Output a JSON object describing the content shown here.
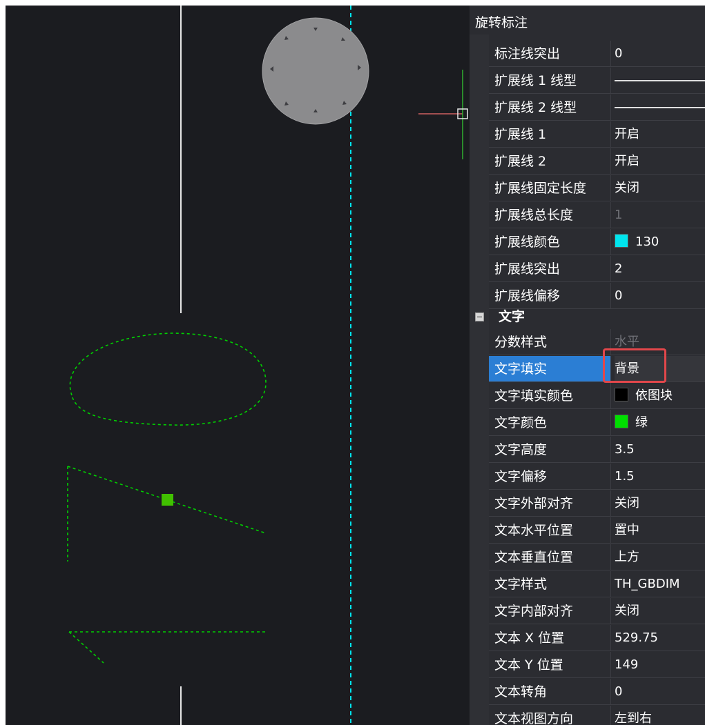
{
  "panel": {
    "title": "旋转标注",
    "section_text": "文字",
    "rows_top": [
      {
        "name": "标注线突出",
        "value": "0"
      },
      {
        "name": "扩展线 1 线型",
        "value": "",
        "kind": "line"
      },
      {
        "name": "扩展线 2 线型",
        "value": "",
        "kind": "line"
      },
      {
        "name": "扩展线 1",
        "value": "开启"
      },
      {
        "name": "扩展线 2",
        "value": "开启"
      },
      {
        "name": "扩展线固定长度",
        "value": "关闭"
      },
      {
        "name": "扩展线总长度",
        "value": "1",
        "dim": true
      },
      {
        "name": "扩展线颜色",
        "value": "130",
        "swatch": "#00e5ee"
      },
      {
        "name": "扩展线突出",
        "value": "2"
      },
      {
        "name": "扩展线偏移",
        "value": "0"
      }
    ],
    "rows_text": [
      {
        "name": "分数样式",
        "value": "水平",
        "dim": true
      },
      {
        "name": "文字填实",
        "value": "背景",
        "selected": true
      },
      {
        "name": "文字填实颜色",
        "value": "依图块",
        "swatch": "#000000"
      },
      {
        "name": "文字颜色",
        "value": "绿",
        "swatch": "#00e000"
      },
      {
        "name": "文字高度",
        "value": "3.5"
      },
      {
        "name": "文字偏移",
        "value": "1.5"
      },
      {
        "name": "文字外部对齐",
        "value": "关闭"
      },
      {
        "name": "文本水平位置",
        "value": "置中"
      },
      {
        "name": "文本垂直位置",
        "value": "上方"
      },
      {
        "name": "文字样式",
        "value": "TH_GBDIM"
      },
      {
        "name": "文字内部对齐",
        "value": "关闭"
      },
      {
        "name": "文本 X 位置",
        "value": "529.75"
      },
      {
        "name": "文本 Y 位置",
        "value": "149"
      },
      {
        "name": "文本转角",
        "value": "0"
      },
      {
        "name": "文本视图方向",
        "value": "左到右"
      }
    ]
  },
  "colors": {
    "canvas_bg": "#1b1c20",
    "panel_bg": "#2b2c31",
    "selection": "#2b7ed4",
    "highlight_box": "#e2474b",
    "dashed_green": "#00d000",
    "cyan_axis": "#00e5ee"
  },
  "icons": {
    "navigation_wheel": "viewcube-disc",
    "crosshair": "cad-cursor",
    "grip": "green-square-grip"
  }
}
